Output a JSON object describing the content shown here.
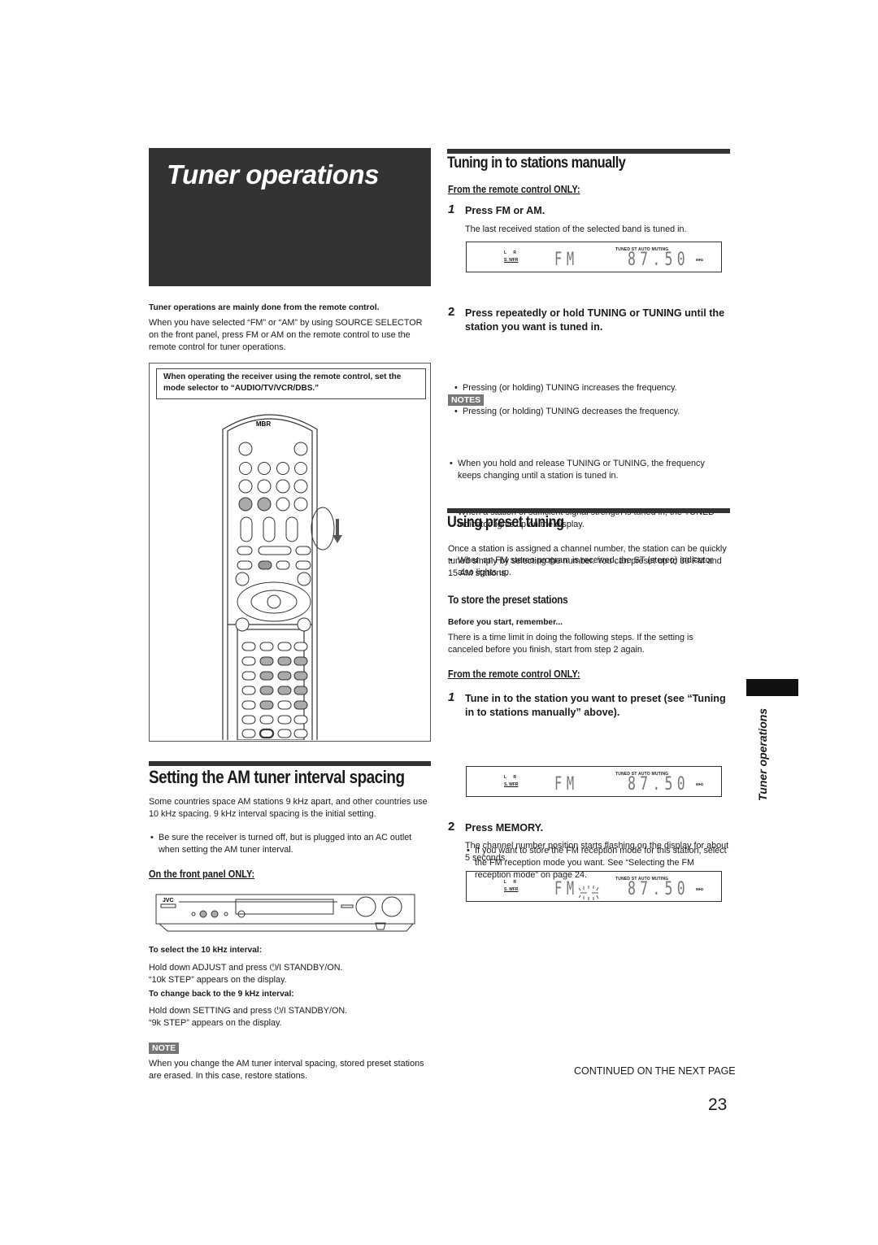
{
  "page": {
    "title": "Tuner operations",
    "side_tab_label": "Tuner operations",
    "page_number": "23",
    "continued": "CONTINUED ON THE NEXT PAGE"
  },
  "intro": {
    "lead_bold": "Tuner operations are mainly done from the remote control.",
    "lead_text": "When you have selected “FM” or “AM” by using SOURCE SELECTOR on the front panel, press FM or AM on the remote control to use the remote control for tuner operations.",
    "mode_note": "When operating the receiver using the remote control, set the mode selector to “AUDIO/TV/VCR/DBS.”",
    "remote_brand": "MBR"
  },
  "am_interval": {
    "heading": "Setting the AM tuner interval spacing",
    "body": "Some countries space AM stations 9 kHz apart, and other countries use 10 kHz spacing. 9 kHz interval spacing is the initial setting.",
    "bullet": "Be sure the receiver is turned off, but is plugged into an AC outlet when setting the AM tuner interval.",
    "front_panel_head": "On the front panel ONLY:",
    "brand": "JVC",
    "select10_head": "To select the 10 kHz interval:",
    "select10_line1": "Hold down ADJUST and press ⏻/I STANDBY/ON.",
    "select10_line2": "“10k STEP” appears on the display.",
    "back9_head": "To change back to the 9 kHz interval:",
    "back9_line1": "Hold down SETTING and press ⏻/I STANDBY/ON.",
    "back9_line2": "“9k STEP” appears on the display.",
    "note_badge": "NOTE",
    "note_text": "When you change the AM tuner interval spacing, stored preset stations are erased. In this case, restore stations."
  },
  "manual_tuning": {
    "heading": "Tuning in to stations manually",
    "remote_only": "From the remote control ONLY:",
    "step1_num": "1",
    "step1_text": "Press FM or AM.",
    "step1_desc": "The last received station of the selected band is tuned in.",
    "step2_num": "2",
    "step2_text": "Press repeatedly or hold TUNING      or      TUNING until the station you want is tuned in.",
    "step2_bullets": [
      "Pressing (or holding) TUNING      increases the frequency.",
      "Pressing (or holding)      TUNING decreases the frequency."
    ],
    "notes_badge": "NOTES",
    "notes": [
      "When you hold and release TUNING      or      TUNING, the frequency keeps changing until a station is tuned in.",
      "When a station of sufficient signal strength is tuned in, the TUNED indicator lights up on the display.",
      "When an FM stereo program is received, the ST (stereo) indicator also lights up."
    ]
  },
  "display": {
    "l": "L",
    "r": "R",
    "swfr": "S. WFR",
    "indicators": "TUNED  ST  AUTO MUTING",
    "band": "FM",
    "frequency": "87.50",
    "unit": "MHz"
  },
  "preset": {
    "heading": "Using preset tuning",
    "body": "Once a station is assigned a channel number, the station can be quickly tuned simply by selecting the number. You can preset up to 30 FM and 15 AM stations.",
    "store_head": "To store the preset stations",
    "before_head": "Before you start, remember...",
    "before_text": "There is a time limit in doing the following steps. If the setting is canceled before you finish, start from step 2 again.",
    "remote_only": "From the remote control ONLY:",
    "step1_num": "1",
    "step1_text": "Tune in to the station you want to preset (see “Tuning in to stations manually” above).",
    "step1_bullet": "If you want to store the FM reception mode for this station, select the FM reception mode you want. See “Selecting the FM reception mode” on page 24.",
    "step2_num": "2",
    "step2_text": "Press MEMORY.",
    "step2_desc": "The channel number position starts flashing on the display for about 5 seconds."
  }
}
